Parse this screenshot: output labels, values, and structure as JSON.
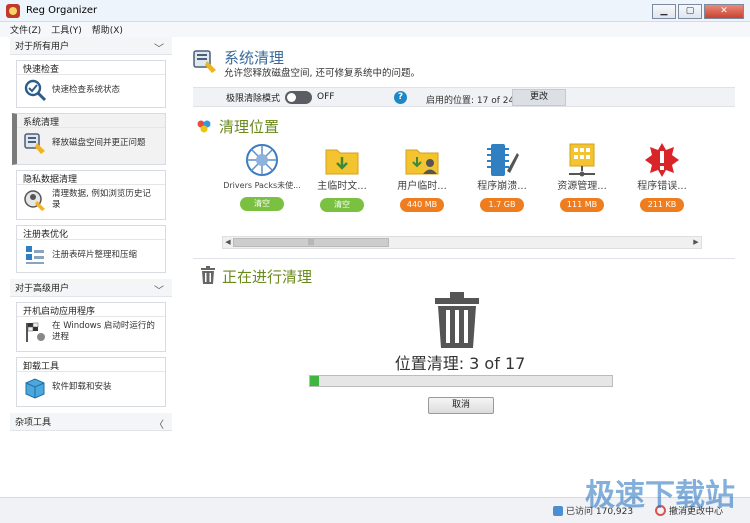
{
  "window": {
    "title": "Reg Organizer"
  },
  "menu": [
    "文件(Z)",
    "工具(Y)",
    "帮助(X)"
  ],
  "sidebar": {
    "all_users_label": "对于所有用户",
    "advanced_users_label": "对于高级用户",
    "misc_label": "杂项工具",
    "items": [
      {
        "title": "快速检查",
        "desc": "快速检查系统状态"
      },
      {
        "title": "系统清理",
        "desc": "释放磁盘空间并更正问题"
      },
      {
        "title": "隐私数据清理",
        "desc": "清理数据, 例如浏览历史记录"
      },
      {
        "title": "注册表优化",
        "desc": "注册表碎片整理和压缩"
      },
      {
        "title": "开机启动应用程序",
        "desc": "在 Windows 启动时运行的进程"
      },
      {
        "title": "卸载工具",
        "desc": "软件卸载和安装"
      }
    ]
  },
  "main": {
    "title": "系统清理",
    "subtitle": "允许您释放磁盘空间, 还可修复系统中的问题。",
    "extreme_mode_label": "极限清除模式",
    "extreme_mode_state": "OFF",
    "help": "?",
    "enabled_locations": "启用的位置: 17 of 24",
    "change_button": "更改",
    "locations_title": "清理位置",
    "locations": [
      {
        "name": "Drivers Packs未使...",
        "badge": "清空",
        "badge_color": "#7ac142"
      },
      {
        "name": "主临时文...",
        "badge": "清空",
        "badge_color": "#7ac142"
      },
      {
        "name": "用户临时...",
        "badge": "440 MB",
        "badge_color": "#ef7d1f"
      },
      {
        "name": "程序崩溃...",
        "badge": "1.7 GB",
        "badge_color": "#ef7d1f"
      },
      {
        "name": "资源管理...",
        "badge": "111 MB",
        "badge_color": "#ef7d1f"
      },
      {
        "name": "程序错误...",
        "badge": "211 KB",
        "badge_color": "#ef7d1f"
      }
    ],
    "scroll_thumb_grip": "|||",
    "cleaning_title": "正在进行清理",
    "progress_text": "位置清理: 3 of 17",
    "progress_value": 0.03,
    "cancel_button": "取消"
  },
  "statusbar": {
    "like_text": "已访问 170,923",
    "undo_text": "撤消更改中心"
  },
  "watermark": "极速下载站",
  "colors": {
    "accent_blue": "#3a6b9a",
    "section_green": "#6b8a1e",
    "progress_green": "#3fb63f"
  }
}
